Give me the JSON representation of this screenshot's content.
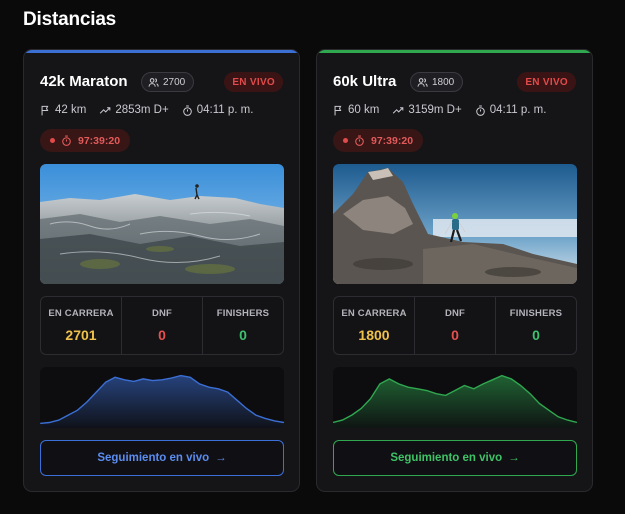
{
  "section": {
    "title": "Distancias"
  },
  "races": [
    {
      "name": "42k Maraton",
      "runners_count": "2700",
      "live_label": "EN VIVO",
      "distance": "42 km",
      "elevation": "2853m D+",
      "start_time": "04:11 p. m.",
      "timer": "97:39:20",
      "accent_color": "#3b6fd4",
      "stats": [
        {
          "label": "EN CARRERA",
          "value": "2701"
        },
        {
          "label": "DNF",
          "value": "0"
        },
        {
          "label": "FINISHERS",
          "value": "0"
        }
      ],
      "profile": [
        2,
        3,
        6,
        12,
        18,
        28,
        40,
        52,
        58,
        55,
        53,
        56,
        54,
        55,
        57,
        60,
        58,
        50,
        46,
        44,
        40,
        30,
        20,
        12,
        8,
        5,
        3
      ],
      "button_label": "Seguimiento en vivo",
      "button_arrow": "→"
    },
    {
      "name": "60k Ultra",
      "runners_count": "1800",
      "live_label": "EN VIVO",
      "distance": "60 km",
      "elevation": "3159m D+",
      "start_time": "04:11 p. m.",
      "timer": "97:39:20",
      "accent_color": "#2fa84f",
      "stats": [
        {
          "label": "EN CARRERA",
          "value": "1800"
        },
        {
          "label": "DNF",
          "value": "0"
        },
        {
          "label": "FINISHERS",
          "value": "0"
        }
      ],
      "profile": [
        3,
        6,
        12,
        20,
        32,
        50,
        56,
        50,
        46,
        44,
        42,
        38,
        36,
        42,
        48,
        44,
        50,
        55,
        60,
        56,
        48,
        38,
        26,
        18,
        10,
        6,
        3
      ],
      "button_label": "Seguimiento en vivo",
      "button_arrow": "→"
    }
  ]
}
